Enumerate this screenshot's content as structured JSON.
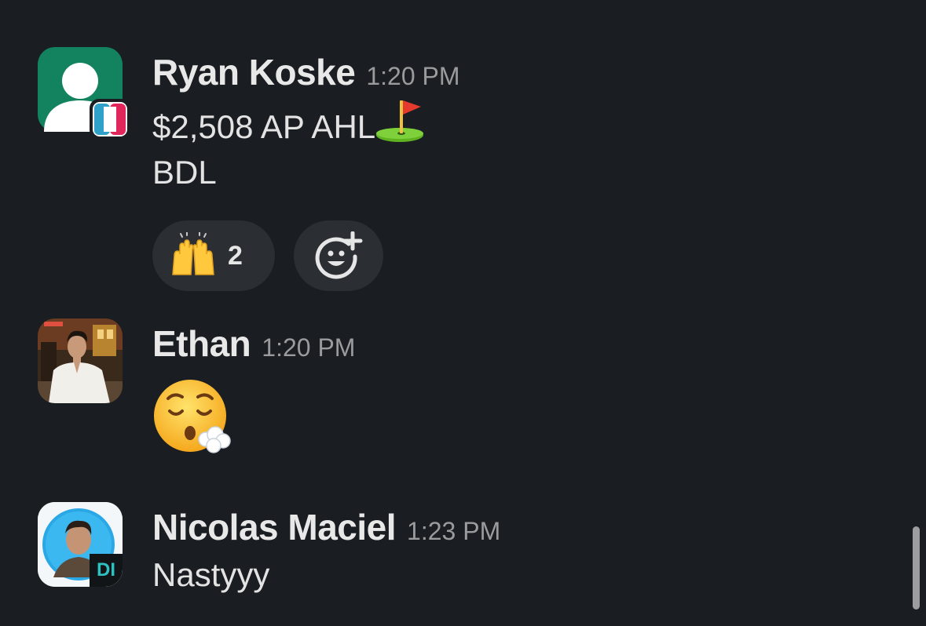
{
  "messages": [
    {
      "author": "Ryan Koske",
      "time": "1:20 PM",
      "avatar_icon": "default-user-avatar-icon",
      "lines": [
        "$2,508 AP AHL",
        "BDL"
      ],
      "inline_emoji": "golf-flag-emoji",
      "reactions": [
        {
          "emoji": "raising-hands-emoji",
          "count": "2"
        }
      ],
      "add_reaction_icon": "add-reaction-icon"
    },
    {
      "author": "Ethan",
      "time": "1:20 PM",
      "avatar_icon": "profile-photo",
      "emoji_message": "face-exhaling-emoji"
    },
    {
      "author": "Nicolas Maciel",
      "time": "1:23 PM",
      "avatar_icon": "profile-photo",
      "lines": [
        "Nastyyy"
      ]
    }
  ],
  "colors": {
    "background": "#1a1d21",
    "reaction_pill": "#2b2e33",
    "default_avatar_green": "#13835f",
    "nicolas_avatar_ring": "#2aa8e6"
  }
}
